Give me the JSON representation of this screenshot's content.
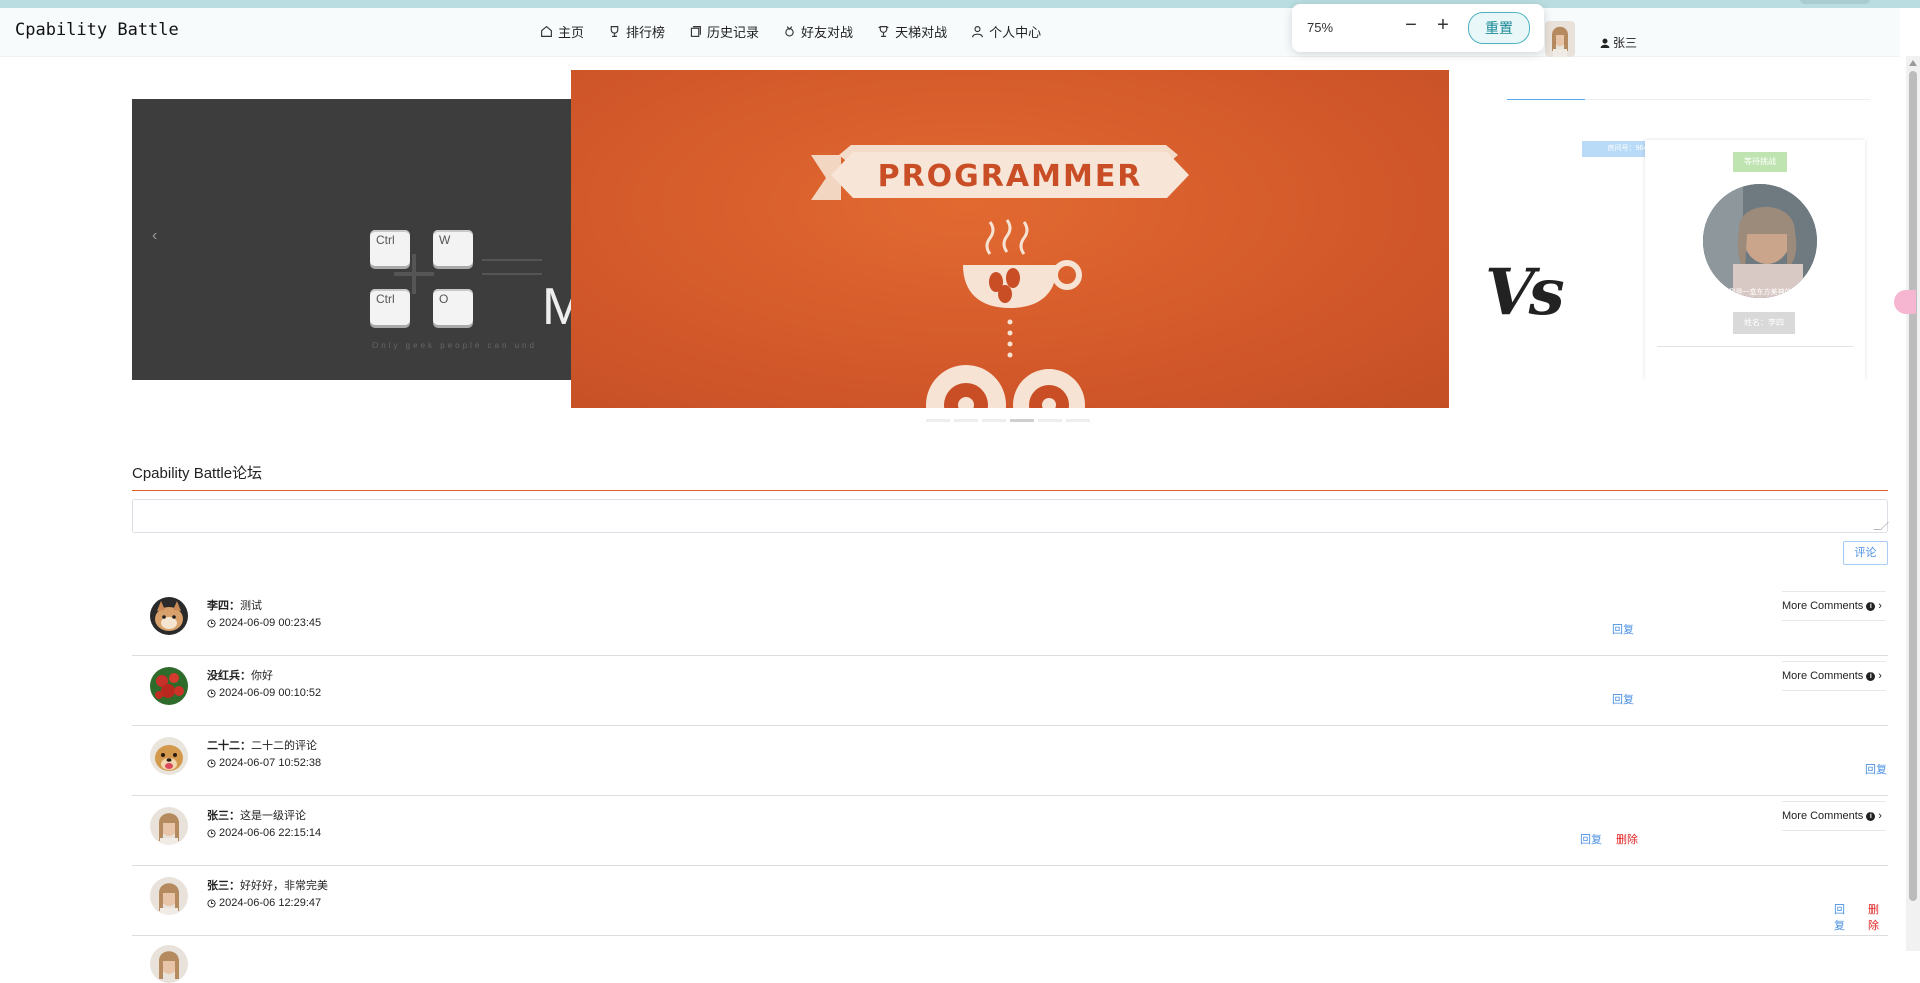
{
  "header": {
    "brand": "Cpability Battle",
    "nav": [
      {
        "label": "主页",
        "icon": "home-icon"
      },
      {
        "label": "排行榜",
        "icon": "trophy-icon"
      },
      {
        "label": "历史记录",
        "icon": "history-icon"
      },
      {
        "label": "好友对战",
        "icon": "medal-icon"
      },
      {
        "label": "天梯对战",
        "icon": "cup-icon"
      },
      {
        "label": "个人中心",
        "icon": "user-icon"
      }
    ],
    "username": "张三"
  },
  "zoom_popup": {
    "value": "75%",
    "minus": "−",
    "plus": "+",
    "reset": "重置"
  },
  "carousel": {
    "keys": [
      "Ctrl",
      "W",
      "Ctrl",
      "O"
    ],
    "big_letter": "M",
    "dark_caption": "Only geek people can und",
    "banner_text": "PROGRAMMER",
    "blue_tag": "房间号：964711",
    "card_badge": "等待挑战",
    "card_name": "姓名：李四",
    "avatar_caption": "我是一盒东方美神的",
    "vs_text": "Vs",
    "prev_arrow": "‹"
  },
  "forum": {
    "title": "Cpability Battle论坛",
    "submit_label": "评论",
    "reply_label": "回复",
    "delete_label": "删除",
    "more_label": "More Comments",
    "comments": [
      {
        "author": "李四",
        "text": "测试",
        "time": "2024-06-09 00:23:45"
      },
      {
        "author": "没红兵",
        "text": "你好",
        "time": "2024-06-09 00:10:52"
      },
      {
        "author": "二十二",
        "text": "二十二的评论",
        "time": "2024-06-07 10:52:38"
      },
      {
        "author": "张三",
        "text": "这是一级评论",
        "time": "2024-06-06 22:15:14"
      },
      {
        "author": "张三",
        "text": "好好好，非常完美",
        "time": "2024-06-06 12:29:47"
      }
    ]
  },
  "colors": {
    "accent_orange": "#e25c25",
    "link_blue": "#4a90e2",
    "delete_red": "#e02020",
    "banner_orange": "#d2582a",
    "reset_teal": "#1a8a96"
  }
}
